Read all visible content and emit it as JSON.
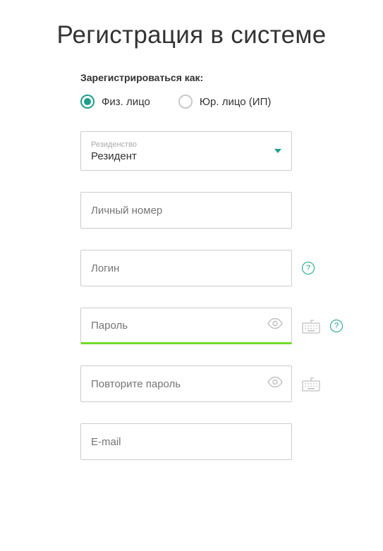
{
  "title": "Регистрация в системе",
  "registerAs": {
    "label": "Зарегистрироваться как:",
    "options": {
      "individual": "Физ. лицо",
      "legal": "Юр. лицо (ИП)"
    }
  },
  "residency": {
    "floatingLabel": "Резиденство",
    "value": "Резидент"
  },
  "fields": {
    "personalNumber": {
      "placeholder": "Личный номер"
    },
    "login": {
      "placeholder": "Логин"
    },
    "password": {
      "placeholder": "Пароль"
    },
    "passwordRepeat": {
      "placeholder": "Повторите пароль"
    },
    "email": {
      "placeholder": "E-mail"
    }
  },
  "help": {
    "symbol": "?"
  }
}
